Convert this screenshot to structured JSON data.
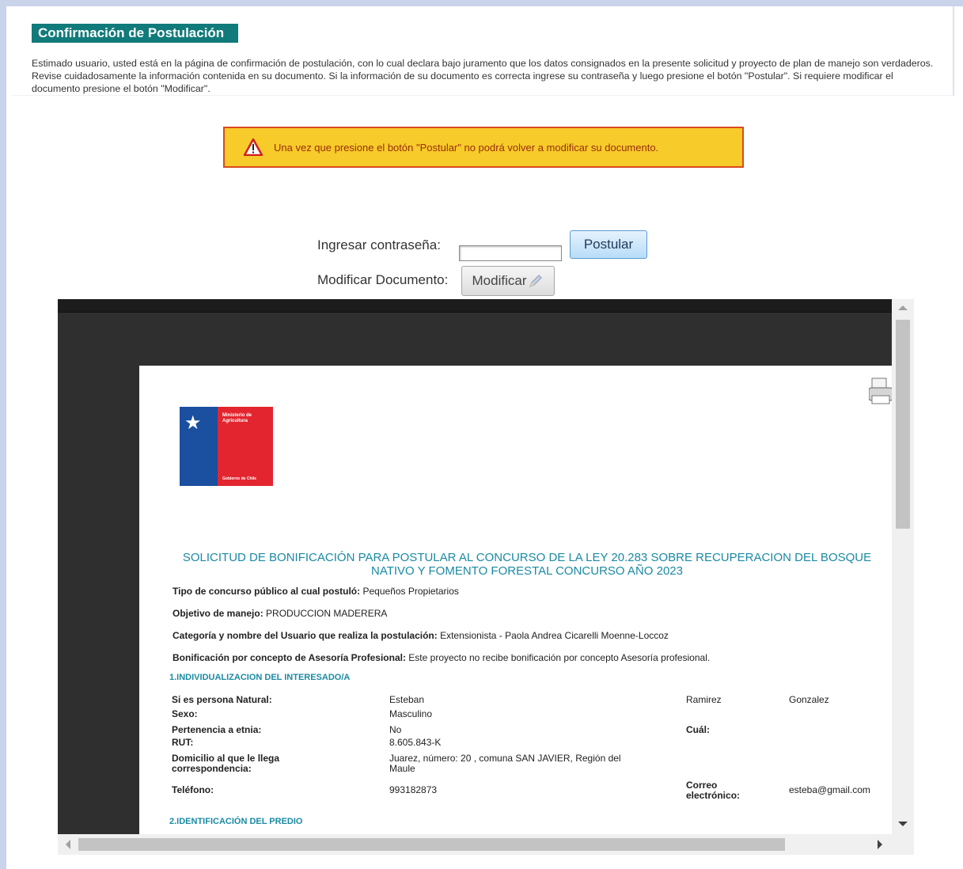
{
  "header": {
    "section_title": "Confirmación de Postulación",
    "intro": "Estimado usuario, usted está en la página de confirmación de postulación, con lo cual declara bajo juramento que los datos consignados en la presente solicitud y proyecto de plan de manejo son verdaderos. Revise cuidadosamente la información contenida en su documento. Si la información de su documento es correcta ingrese su contraseña y luego presione el botón \"Postular\". Si requiere modificar el documento presione el botón \"Modificar\"."
  },
  "warning": {
    "text": "Una vez que presione el botón \"Postular\" no podrá volver a modificar su documento."
  },
  "form": {
    "password_label": "Ingresar contraseña:",
    "password_value": "",
    "postular_label": "Postular",
    "modify_label": "Modificar Documento:",
    "modificar_button": "Modificar"
  },
  "document": {
    "logo_text": "Ministerio de Agricultura",
    "logo_footer": "Gobierno de Chile",
    "title_line1": "SOLICITUD DE BONIFICACIÓN PARA POSTULAR AL CONCURSO DE LA LEY 20.283 SOBRE RECUPERACION DEL BOSQUE",
    "title_line2": "NATIVO Y FOMENTO FORESTAL CONCURSO AÑO 2023",
    "fields": [
      {
        "label": "Tipo de concurso público al cual postuló:",
        "value": "Pequeños Propietarios"
      },
      {
        "label": "Objetivo de manejo:",
        "value": "PRODUCCION MADERERA"
      },
      {
        "label": "Categoría y nombre del Usuario que realiza la postulación:",
        "value": "Extensionista - Paola Andrea Cicarelli Moenne-Loccoz"
      },
      {
        "label": "Bonificación por concepto de Asesoría Profesional:",
        "value": "Este proyecto no recibe bonificación por concepto Asesoría profesional."
      }
    ],
    "section1": "1.INDIVIDUALIZACION DEL INTERESADO/A",
    "persona_label": "Si es persona Natural:",
    "nombre": "Esteban",
    "apellido1": "Ramirez",
    "apellido2": "Gonzalez",
    "sexo_label": "Sexo:",
    "sexo": "Masculino",
    "etnia_label": "Pertenencia a etnia:",
    "etnia": "No",
    "cual_label": "Cuál:",
    "rut_label": "RUT:",
    "rut": "8.605.843-K",
    "domicilio_label_1": "Domicilio al que le llega",
    "domicilio_label_2": "correspondencia:",
    "domicilio_1": "Juarez, número: 20 , comuna SAN JAVIER, Región del",
    "domicilio_2": "Maule",
    "telefono_label": "Teléfono:",
    "telefono": "993182873",
    "correo_label_1": "Correo",
    "correo_label_2": "electrónico:",
    "correo": "esteba@gmail.com",
    "section2": "2.IDENTIFICACIÓN DEL PREDIO"
  },
  "colors": {
    "title_bg": "#117a7a",
    "warning_bg": "#f7cb2a",
    "warning_border": "#d94a1f",
    "doc_accent": "#1a8aa3"
  }
}
